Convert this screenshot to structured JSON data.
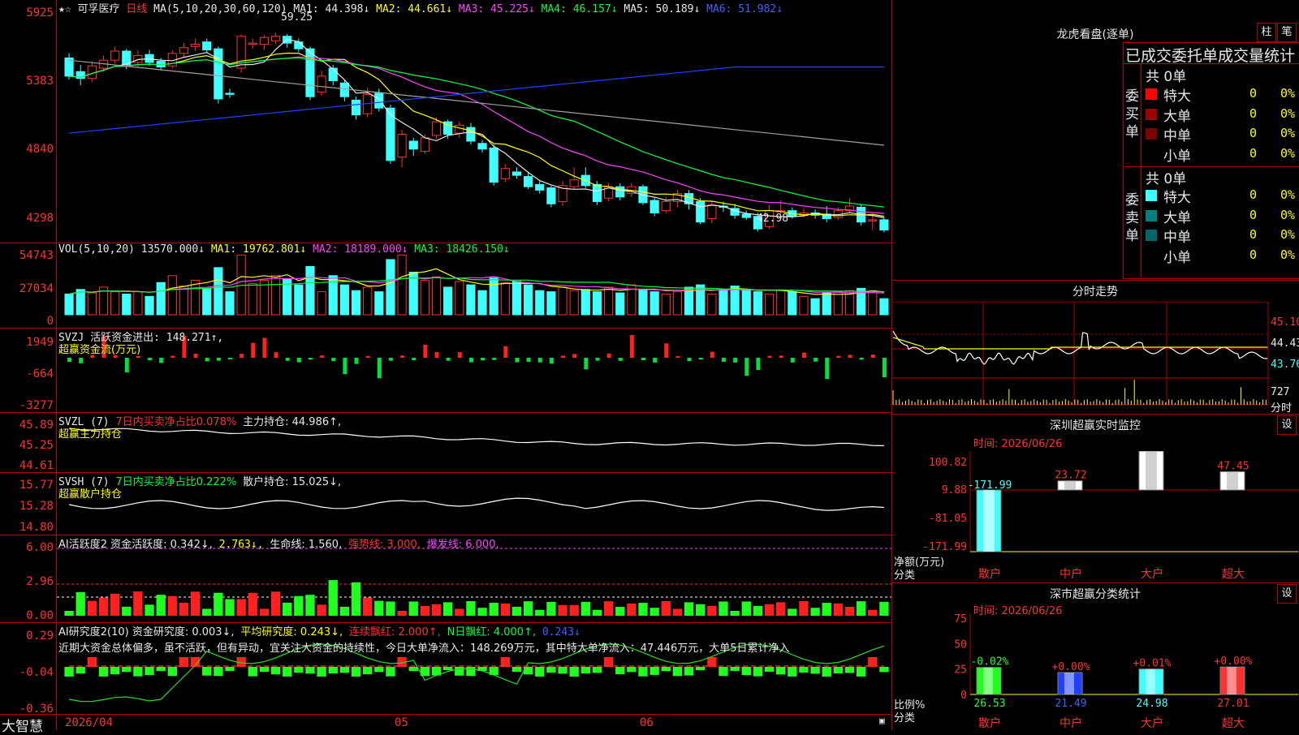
{
  "stock": {
    "name": "可孚医疗",
    "period": "日线"
  },
  "main_legend": {
    "ma_label": "MA(5,10,20,30,60,120)",
    "ma1": "MA1: 44.398↓",
    "ma2": "MA2: 44.661↓",
    "ma3": "MA3: 45.225↓",
    "ma4": "MA4: 46.157↓",
    "ma5": "MA5: 50.189↓",
    "ma6": "MA6: 51.982↓",
    "high_mark": "59.25",
    "low_mark": "42.98"
  },
  "price_axis": [
    "5925",
    "5383",
    "4840",
    "4298"
  ],
  "vol_legend": {
    "label": "VOL(5,10,20)",
    "v": "13570.000↓",
    "ma1": "MA1: 19762.801↓",
    "ma2": "MA2: 18189.000↓",
    "ma3": "MA3: 18426.150↓"
  },
  "vol_axis": [
    "54743",
    "27034",
    "0"
  ],
  "svzj": {
    "label": "SVZJ  活跃资金进出: 148.271↑,",
    "sub": "超赢资金流(万元)",
    "axis": [
      "1949",
      "-664",
      "-3277"
    ]
  },
  "svzl": {
    "label": "SVZL (7)",
    "pct": "7日内买卖净占比0.078%",
    "hold": "主力持仓: 44.986↑,",
    "sub": "超赢主力持仓",
    "axis": [
      "45.89",
      "45.25",
      "44.61"
    ]
  },
  "svsh": {
    "label": "SVSH (7)",
    "pct": "7日内买卖净占比0.222%",
    "hold": "散户持仓: 15.025↓,",
    "sub": "超赢散户持仓",
    "axis": [
      "15.77",
      "15.28",
      "14.80"
    ]
  },
  "ai1": {
    "label": "AI活跃度2 资金活跃度: 0.342↓,",
    "v2": "2.763↓,",
    "life": "生命线: 1.560,",
    "strong": "强势线: 3.000,",
    "burst": "爆发线: 6.000,",
    "axis": [
      "6.00",
      "2.96",
      "0.00"
    ]
  },
  "ai2": {
    "label": "AI研究度2(10) 资金研究度: 0.003↓,",
    "avg": "平均研究度: 0.243↓,",
    "lx": "连续飘红: 2.000↑,",
    "nx": "N日飘红: 4.000↑,",
    "v": "0.243↓",
    "text": "近期大资金总体偏多，虽不活跃，但有异动，宜关注大资金的持续性，今日大单净流入：148.269万元，其中特大单净流入：47.446万元，大单5日累计净入",
    "axis": [
      "0.29",
      "-0.04",
      "-0.36"
    ]
  },
  "date_axis": {
    "d1": "2026/04",
    "d2": "05",
    "d3": "06"
  },
  "brand": "大智慧",
  "lhb": {
    "title": "龙虎看盘(逐单)",
    "btn1": "柱",
    "btn2": "笔",
    "tabs": "已成交委托单成交量统计",
    "buy_label": "委买单",
    "sell_label": "委卖单",
    "buy_total": "共 0单",
    "sell_total": "共 0单",
    "rows": [
      "特大",
      "大单",
      "中单",
      "小单"
    ],
    "zero": "0",
    "pct": "0%"
  },
  "fenshi": {
    "title": "分时走势",
    "axis": [
      "45.10",
      "44.43",
      "43.76"
    ],
    "vol": "727",
    "unit": "分时"
  },
  "sz_monitor": {
    "title": "深圳超赢实时监控",
    "btn": "设",
    "time": "时间: 2026/06/26",
    "axis": [
      "100.82",
      "9.88",
      "-81.05",
      "-171.99"
    ],
    "bars": [
      {
        "cat": "散户",
        "val": "-171.99"
      },
      {
        "cat": "中户",
        "val": "23.72"
      },
      {
        "cat": "大户",
        "val": "100.82"
      },
      {
        "cat": "超大",
        "val": "47.45"
      }
    ],
    "ylabel": "净额(万元)",
    "xlabel": "分类"
  },
  "sz_class": {
    "title": "深市超赢分类统计",
    "btn": "设",
    "time": "时间: 2026/06/26",
    "axis": [
      "75",
      "50",
      "25",
      "0"
    ],
    "bars": [
      {
        "cat": "散户",
        "val": "26.53",
        "chg": "-0.02%"
      },
      {
        "cat": "中户",
        "val": "21.49",
        "chg": "+0.00%"
      },
      {
        "cat": "大户",
        "val": "24.98",
        "chg": "+0.01%"
      },
      {
        "cat": "超大",
        "val": "27.01",
        "chg": "+0.00%"
      }
    ],
    "ylabel": "比例%",
    "xlabel": "分类"
  },
  "chart_data": {
    "type": "bar",
    "categories": [
      "散户",
      "中户",
      "大户",
      "超大"
    ],
    "series": [
      {
        "name": "净额(万元)",
        "values": [
          -171.99,
          23.72,
          100.82,
          47.45
        ]
      },
      {
        "name": "比例%",
        "values": [
          26.53,
          21.49,
          24.98,
          27.01
        ]
      }
    ],
    "title": "深圳超赢实时监控",
    "xlabel": "分类",
    "ylabel": "净额(万元)",
    "ylim": [
      -171.99,
      100.82
    ]
  },
  "candles": [
    [
      57.2,
      55.6,
      57.6,
      55.3
    ],
    [
      56.0,
      55.4,
      56.6,
      54.8
    ],
    [
      55.4,
      56.5,
      56.9,
      55.1
    ],
    [
      56.3,
      57.0,
      57.4,
      56.0
    ],
    [
      57.0,
      57.8,
      58.2,
      56.7
    ],
    [
      57.8,
      56.6,
      58.0,
      56.2
    ],
    [
      56.8,
      57.4,
      57.9,
      56.4
    ],
    [
      57.5,
      56.8,
      57.9,
      56.5
    ],
    [
      56.9,
      56.4,
      57.2,
      56.1
    ],
    [
      56.5,
      57.6,
      57.9,
      56.3
    ],
    [
      57.6,
      58.1,
      58.5,
      57.2
    ],
    [
      58.2,
      58.4,
      58.9,
      57.8
    ],
    [
      58.6,
      57.9,
      58.9,
      57.6
    ],
    [
      58.0,
      53.6,
      58.2,
      53.2
    ],
    [
      54.1,
      54.0,
      54.5,
      53.7
    ],
    [
      56.3,
      59.1,
      59.25,
      55.9
    ],
    [
      58.4,
      58.5,
      58.9,
      58.0
    ],
    [
      58.4,
      59.0,
      59.2,
      57.9
    ],
    [
      58.7,
      59.1,
      59.4,
      58.4
    ],
    [
      59.1,
      58.5,
      59.3,
      58.1
    ],
    [
      58.6,
      58.0,
      58.9,
      57.7
    ],
    [
      58.0,
      53.8,
      58.2,
      53.5
    ],
    [
      54.2,
      55.6,
      56.1,
      53.9
    ],
    [
      56.3,
      55.2,
      56.6,
      54.8
    ],
    [
      55.0,
      53.8,
      55.3,
      53.4
    ],
    [
      53.5,
      52.2,
      53.8,
      51.8
    ],
    [
      52.3,
      54.0,
      54.6,
      52.0
    ],
    [
      54.1,
      52.8,
      54.5,
      52.5
    ],
    [
      52.8,
      48.2,
      53.1,
      47.9
    ],
    [
      48.5,
      50.5,
      50.9,
      47.6
    ],
    [
      49.9,
      49.2,
      50.2,
      48.6
    ],
    [
      49.0,
      50.2,
      50.5,
      48.8
    ],
    [
      50.4,
      51.6,
      52.0,
      50.1
    ],
    [
      51.6,
      50.5,
      51.8,
      50.1
    ],
    [
      50.6,
      51.3,
      51.6,
      50.2
    ],
    [
      51.1,
      49.9,
      51.5,
      49.6
    ],
    [
      49.7,
      49.2,
      50.0,
      48.9
    ],
    [
      49.3,
      46.3,
      49.6,
      46.0
    ],
    [
      46.6,
      47.5,
      47.9,
      46.3
    ],
    [
      47.2,
      46.9,
      47.6,
      46.6
    ],
    [
      46.8,
      45.9,
      47.2,
      45.7
    ],
    [
      46.1,
      45.6,
      46.4,
      45.3
    ],
    [
      45.8,
      44.4,
      46.0,
      44.1
    ],
    [
      44.6,
      46.0,
      46.4,
      44.2
    ],
    [
      45.9,
      46.5,
      47.6,
      45.7
    ],
    [
      46.9,
      46.0,
      47.6,
      45.8
    ],
    [
      46.1,
      44.6,
      46.4,
      44.3
    ],
    [
      44.9,
      45.9,
      46.2,
      44.6
    ],
    [
      45.9,
      45.0,
      46.2,
      44.7
    ],
    [
      45.3,
      45.9,
      46.2,
      45.0
    ],
    [
      45.9,
      44.5,
      46.1,
      44.3
    ],
    [
      44.7,
      43.6,
      44.9,
      43.3
    ],
    [
      43.8,
      44.6,
      45.0,
      43.6
    ],
    [
      44.6,
      45.3,
      45.6,
      44.1
    ],
    [
      45.3,
      44.4,
      45.6,
      43.9
    ],
    [
      44.6,
      42.8,
      44.9,
      42.6
    ],
    [
      43.1,
      44.3,
      44.6,
      42.7
    ],
    [
      44.2,
      44.1,
      44.6,
      43.7
    ],
    [
      44.0,
      43.4,
      44.4,
      43.1
    ],
    [
      43.5,
      43.2,
      43.8,
      43.0
    ],
    [
      43.3,
      42.2,
      43.6,
      41.98
    ],
    [
      42.4,
      43.8,
      44.3,
      42.2
    ],
    [
      43.7,
      43.8,
      44.7,
      43.5
    ],
    [
      43.8,
      43.3,
      44.1,
      43.1
    ],
    [
      43.4,
      43.6,
      44.0,
      43.2
    ],
    [
      43.6,
      43.4,
      43.9,
      43.1
    ],
    [
      43.5,
      43.1,
      44.2,
      42.8
    ],
    [
      43.2,
      43.8,
      44.1,
      43.0
    ],
    [
      43.8,
      44.2,
      44.9,
      43.6
    ],
    [
      44.1,
      42.8,
      44.4,
      42.5
    ],
    [
      42.9,
      43.0,
      43.5,
      42.1
    ],
    [
      43.0,
      42.1,
      43.2,
      41.9
    ]
  ],
  "volumes": [
    18,
    22,
    19,
    24,
    20,
    18,
    20,
    16,
    28,
    34,
    25,
    30,
    23,
    41,
    20,
    52,
    27,
    30,
    34,
    31,
    26,
    42,
    20,
    34,
    26,
    21,
    24,
    20,
    48,
    52,
    37,
    30,
    33,
    24,
    29,
    26,
    21,
    32,
    28,
    29,
    26,
    21,
    20,
    24,
    21,
    22,
    20,
    24,
    19,
    26,
    22,
    20,
    18,
    20,
    24,
    26,
    18,
    21,
    25,
    22,
    20,
    18,
    21,
    20,
    16,
    14,
    19,
    20,
    21,
    23,
    21,
    14
  ]
}
